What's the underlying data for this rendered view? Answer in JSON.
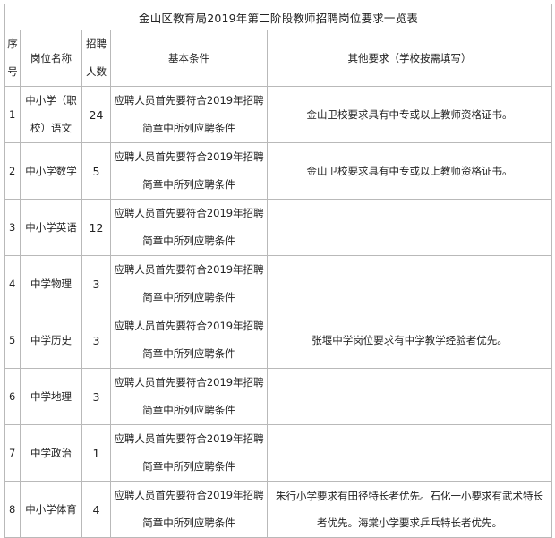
{
  "table": {
    "title": "金山区教育局2019年第二阶段教师招聘岗位要求一览表",
    "headers": {
      "no": "序号",
      "position": "岗位名称",
      "count": "招聘人数",
      "basic": "基本条件",
      "other": "其他要求（学校按需填写）"
    },
    "rows": [
      {
        "no": "1",
        "position": "中小学（职校）语文",
        "count": "24",
        "basic": "应聘人员首先要符合2019年招聘简章中所列应聘条件",
        "other": "金山卫校要求具有中专或以上教师资格证书。"
      },
      {
        "no": "2",
        "position": "中小学数学",
        "count": "5",
        "basic": "应聘人员首先要符合2019年招聘简章中所列应聘条件",
        "other": "金山卫校要求具有中专或以上教师资格证书。"
      },
      {
        "no": "3",
        "position": "中小学英语",
        "count": "12",
        "basic": "应聘人员首先要符合2019年招聘简章中所列应聘条件",
        "other": ""
      },
      {
        "no": "4",
        "position": "中学物理",
        "count": "3",
        "basic": "应聘人员首先要符合2019年招聘简章中所列应聘条件",
        "other": ""
      },
      {
        "no": "5",
        "position": "中学历史",
        "count": "3",
        "basic": "应聘人员首先要符合2019年招聘简章中所列应聘条件",
        "other": "张堰中学岗位要求有中学教学经验者优先。"
      },
      {
        "no": "6",
        "position": "中学地理",
        "count": "3",
        "basic": "应聘人员首先要符合2019年招聘简章中所列应聘条件",
        "other": ""
      },
      {
        "no": "7",
        "position": "中学政治",
        "count": "1",
        "basic": "应聘人员首先要符合2019年招聘简章中所列应聘条件",
        "other": ""
      },
      {
        "no": "8",
        "position": "中小学体育",
        "count": "4",
        "basic": "应聘人员首先要符合2019年招聘简章中所列应聘条件",
        "other": "朱行小学要求有田径特长者优先。石化一小要求有武术特长者优先。海棠小学要求乒乓特长者优先。"
      }
    ]
  }
}
